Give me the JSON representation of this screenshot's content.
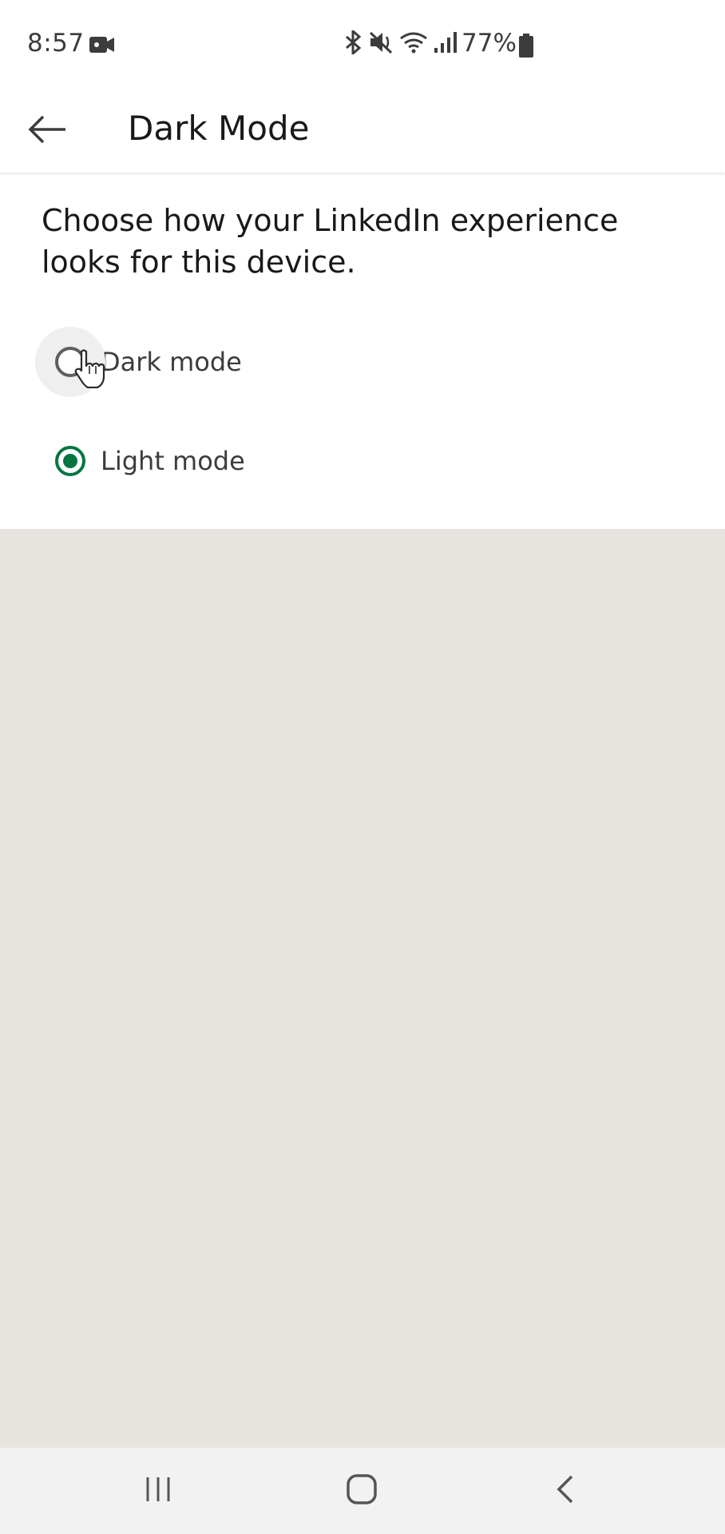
{
  "status_bar": {
    "time": "8:57",
    "battery_percent": "77%",
    "icons": [
      "video-camera-icon",
      "bluetooth-icon",
      "mute-icon",
      "wifi-icon",
      "signal-icon",
      "battery-icon"
    ]
  },
  "header": {
    "title": "Dark Mode",
    "back_icon": "arrow-left-icon"
  },
  "content": {
    "description": "Choose how your LinkedIn experience looks for this device.",
    "options": [
      {
        "label": "Dark mode",
        "selected": false
      },
      {
        "label": "Light mode",
        "selected": true
      }
    ]
  },
  "nav_bar": {
    "icons": [
      "recent-apps-icon",
      "home-icon",
      "back-icon"
    ]
  },
  "colors": {
    "accent": "#057642",
    "background": "#e7e4e0",
    "surface": "#ffffff"
  }
}
